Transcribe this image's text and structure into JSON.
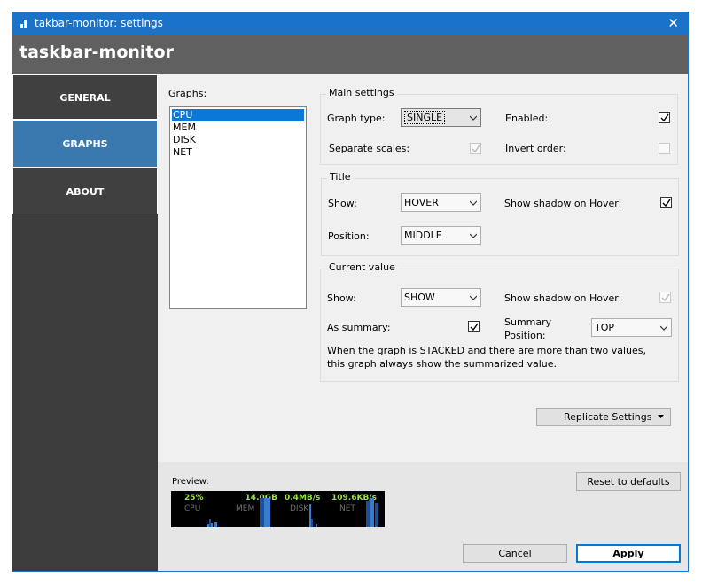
{
  "window": {
    "title": "takbar-monitor: settings",
    "close_glyph": "✕"
  },
  "header": {
    "title": "taskbar-monitor"
  },
  "sidebar": {
    "items": [
      {
        "label": "GENERAL",
        "active": false
      },
      {
        "label": "GRAPHS",
        "active": true
      },
      {
        "label": "ABOUT",
        "active": false
      }
    ]
  },
  "graphs": {
    "label": "Graphs:",
    "items": [
      "CPU",
      "MEM",
      "DISK",
      "NET"
    ],
    "selected": "CPU"
  },
  "main_settings": {
    "title": "Main settings",
    "graph_type_label": "Graph type:",
    "graph_type_value": "SINGLE",
    "enabled_label": "Enabled:",
    "enabled": true,
    "separate_scales_label": "Separate scales:",
    "separate_scales": true,
    "invert_order_label": "Invert order:",
    "invert_order": false
  },
  "title_section": {
    "title": "Title",
    "show_label": "Show:",
    "show_value": "HOVER",
    "shadow_label": "Show shadow on Hover:",
    "shadow": true,
    "position_label": "Position:",
    "position_value": "MIDDLE"
  },
  "current_value": {
    "title": "Current value",
    "show_label": "Show:",
    "show_value": "SHOW",
    "shadow_label": "Show shadow on Hover:",
    "shadow": true,
    "summary_label": "As summary:",
    "summary": true,
    "summary_position_label_1": "Summary",
    "summary_position_label_2": "Position:",
    "summary_position_value": "TOP",
    "note_1": "When the graph is STACKED and there are more than two values,",
    "note_2": "this graph always show the summarized value."
  },
  "buttons": {
    "replicate": "Replicate Settings",
    "reset": "Reset to defaults",
    "cancel": "Cancel",
    "apply": "Apply"
  },
  "preview": {
    "label": "Preview:",
    "cells": [
      {
        "value": "25%",
        "name": "CPU"
      },
      {
        "value": "14.0GB",
        "name": "MEM"
      },
      {
        "value": "0.4MB/s",
        "name": "DISK"
      },
      {
        "value": "109.6KB/s",
        "name": "NET"
      }
    ]
  },
  "colors": {
    "accent": "#1a73c8",
    "nav_active": "#3a78b0",
    "preview_text": "#9be04a",
    "preview_bar": "#3a7bd0"
  }
}
